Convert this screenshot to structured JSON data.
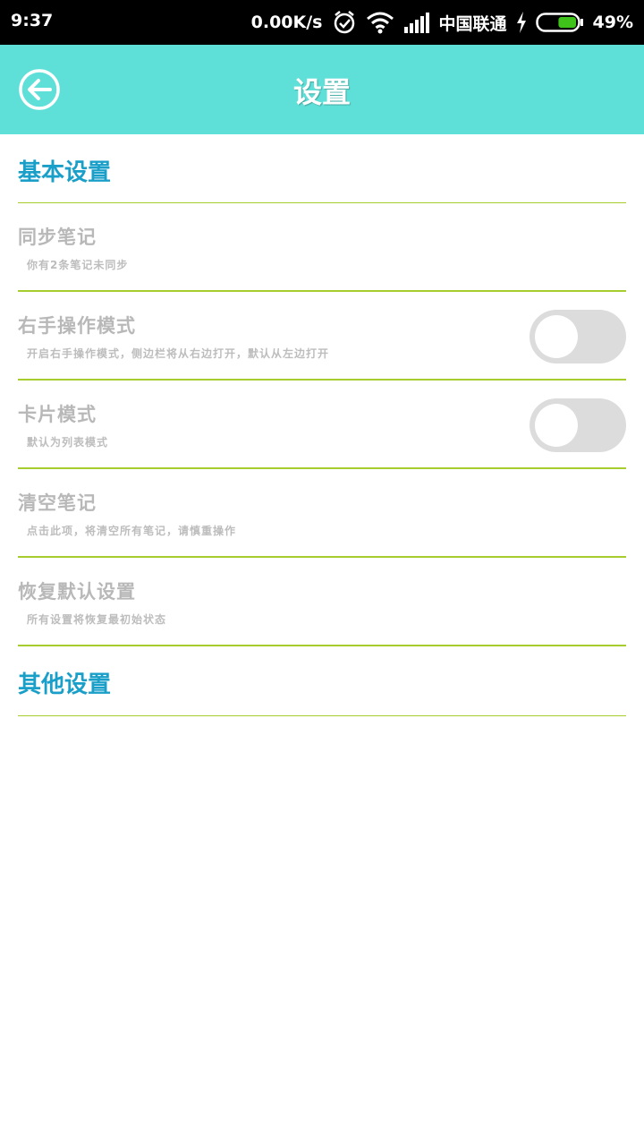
{
  "status_bar": {
    "time": "9:37",
    "net_speed": "0.00K/s",
    "carrier": "中国联通",
    "battery_pct": "49%",
    "battery_level": 0.49,
    "icons": [
      "alarm-icon",
      "wifi-icon",
      "signal-icon",
      "charging-icon",
      "battery-icon"
    ]
  },
  "toolbar": {
    "title": "设置",
    "back_icon": "back-arrow-icon",
    "bg_color": "#5ee0d8"
  },
  "sections": {
    "basic": {
      "header": "基本设置",
      "items": [
        {
          "title": "同步笔记",
          "summary": "你有2条笔记未同步"
        },
        {
          "title": "右手操作模式",
          "summary": "开启右手操作模式，侧边栏将从右边打开，默认从左边打开",
          "switch_on": false
        },
        {
          "title": "卡片模式",
          "summary": "默认为列表模式",
          "switch_on": false
        },
        {
          "title": "清空笔记",
          "summary": "点击此项，将清空所有笔记，请慎重操作"
        },
        {
          "title": "恢复默认设置",
          "summary": "所有设置将恢复最初始状态"
        }
      ]
    },
    "other": {
      "header": "其他设置"
    }
  },
  "colors": {
    "accent": "#1a9fc9",
    "divider": "#a6cc2e",
    "disabled_text": "#b8b8b8"
  }
}
